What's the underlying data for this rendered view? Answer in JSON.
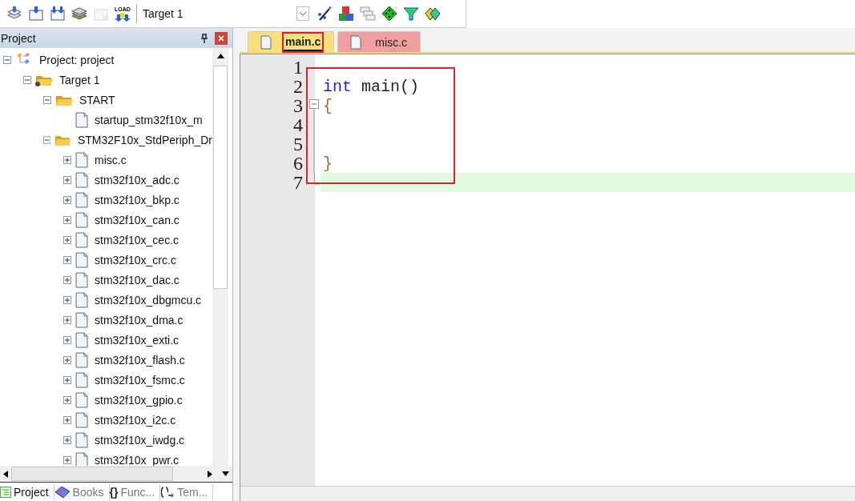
{
  "toolbar": {
    "buttons": [
      {
        "kind": "build-all",
        "disabled": false
      },
      {
        "kind": "download",
        "disabled": false
      },
      {
        "kind": "download-double",
        "disabled": false
      },
      {
        "kind": "layers",
        "disabled": false
      },
      {
        "kind": "batch",
        "disabled": true
      },
      {
        "kind": "load",
        "label": "LOAD",
        "disabled": false
      }
    ],
    "target": {
      "value": "Target 1"
    },
    "tools": [
      {
        "kind": "wand"
      },
      {
        "kind": "blocks"
      },
      {
        "kind": "windows"
      },
      {
        "kind": "diamond"
      },
      {
        "kind": "funnel"
      },
      {
        "kind": "packs"
      }
    ]
  },
  "project_panel": {
    "title": "Project",
    "tree": [
      {
        "label": "Project: project",
        "kind": "project",
        "expanded": true,
        "children": [
          {
            "label": "Target 1",
            "kind": "target",
            "expanded": true,
            "children": [
              {
                "label": "START",
                "kind": "folder",
                "expanded": true,
                "children": [
                  {
                    "label": "startup_stm32f10x_m",
                    "kind": "file"
                  }
                ]
              },
              {
                "label": "STM32F10x_StdPeriph_Dr",
                "kind": "folder",
                "expanded": true,
                "children": [
                  {
                    "label": "misc.c",
                    "kind": "file",
                    "expanded": false
                  },
                  {
                    "label": "stm32f10x_adc.c",
                    "kind": "file",
                    "expanded": false
                  },
                  {
                    "label": "stm32f10x_bkp.c",
                    "kind": "file",
                    "expanded": false
                  },
                  {
                    "label": "stm32f10x_can.c",
                    "kind": "file",
                    "expanded": false
                  },
                  {
                    "label": "stm32f10x_cec.c",
                    "kind": "file",
                    "expanded": false
                  },
                  {
                    "label": "stm32f10x_crc.c",
                    "kind": "file",
                    "expanded": false
                  },
                  {
                    "label": "stm32f10x_dac.c",
                    "kind": "file",
                    "expanded": false
                  },
                  {
                    "label": "stm32f10x_dbgmcu.c",
                    "kind": "file",
                    "expanded": false
                  },
                  {
                    "label": "stm32f10x_dma.c",
                    "kind": "file",
                    "expanded": false
                  },
                  {
                    "label": "stm32f10x_exti.c",
                    "kind": "file",
                    "expanded": false
                  },
                  {
                    "label": "stm32f10x_flash.c",
                    "kind": "file",
                    "expanded": false
                  },
                  {
                    "label": "stm32f10x_fsmc.c",
                    "kind": "file",
                    "expanded": false
                  },
                  {
                    "label": "stm32f10x_gpio.c",
                    "kind": "file",
                    "expanded": false
                  },
                  {
                    "label": "stm32f10x_i2c.c",
                    "kind": "file",
                    "expanded": false
                  },
                  {
                    "label": "stm32f10x_iwdg.c",
                    "kind": "file",
                    "expanded": false
                  },
                  {
                    "label": "stm32f10x_pwr.c",
                    "kind": "file",
                    "expanded": false
                  }
                ]
              }
            ]
          }
        ]
      }
    ],
    "bottom_tabs": [
      {
        "label": "Project",
        "kind": "project",
        "selected": true
      },
      {
        "label": "Books",
        "kind": "books",
        "selected": false
      },
      {
        "label": "Func...",
        "kind": "functions",
        "icon": "{}",
        "selected": false
      },
      {
        "label": "Tem...",
        "kind": "templates",
        "selected": false
      }
    ]
  },
  "editor": {
    "tabs": [
      {
        "label": "main.c",
        "selected": true,
        "marked": true
      },
      {
        "label": "misc.c",
        "selected": false,
        "marked": false
      }
    ],
    "code_marked": true,
    "lines": [
      {
        "number": "1",
        "kind": "plain",
        "current": false
      },
      {
        "number": "2",
        "kind": "plain",
        "tokens": [
          {
            "text": "int",
            "kind": "keyword"
          },
          {
            "text": " main()",
            "kind": "plain"
          }
        ],
        "current": false
      },
      {
        "number": "3",
        "kind": "fold-start",
        "tokens": [
          {
            "text": "{",
            "kind": "brace"
          }
        ],
        "current": false
      },
      {
        "number": "4",
        "kind": "fold-line",
        "current": false
      },
      {
        "number": "5",
        "kind": "fold-line",
        "current": false
      },
      {
        "number": "6",
        "kind": "fold-line",
        "tokens": [
          {
            "text": "}",
            "kind": "brace"
          }
        ],
        "current": false
      },
      {
        "number": "7",
        "kind": "fold-end",
        "current": true
      }
    ]
  }
}
